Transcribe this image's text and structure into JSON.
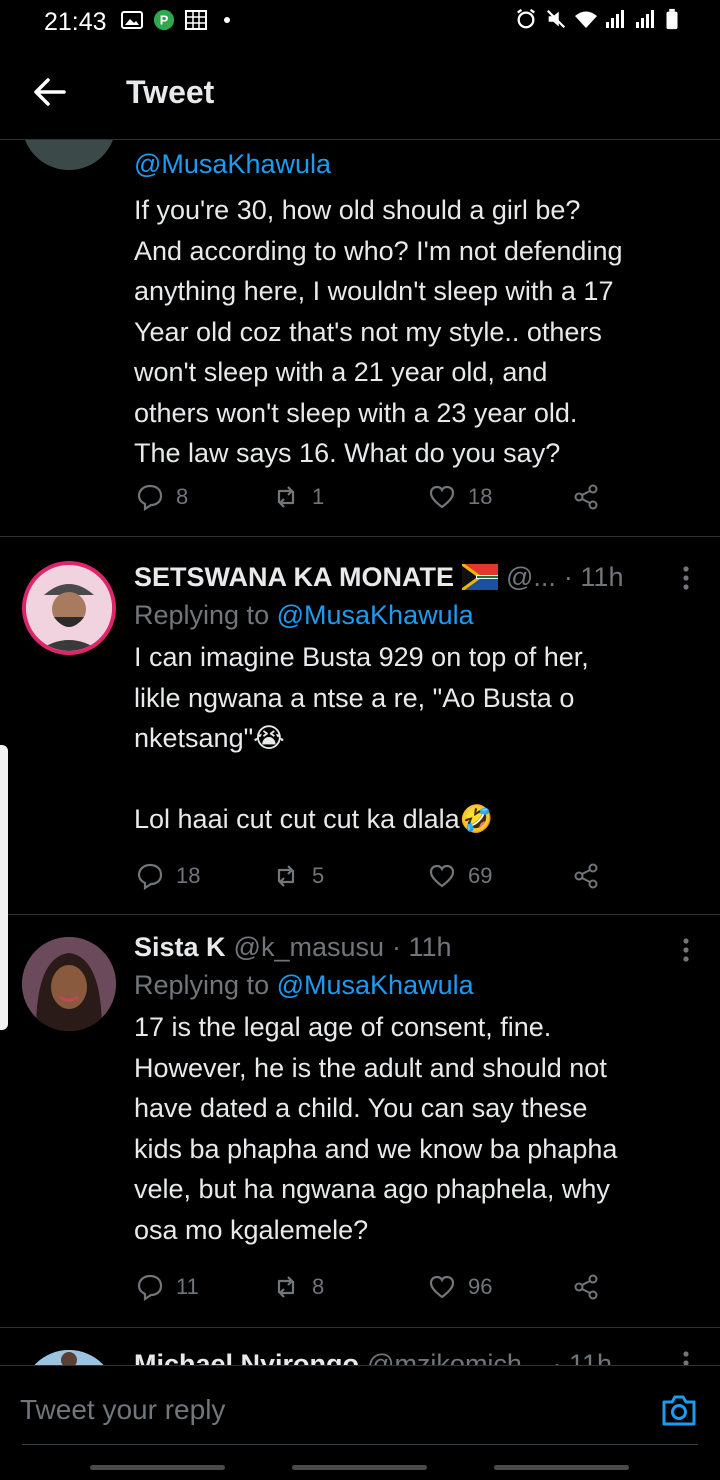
{
  "status_bar": {
    "time": "21:43"
  },
  "header": {
    "title": "Tweet"
  },
  "tweets": [
    {
      "handle": "@MusaKhawula",
      "lines": [
        "If you're 30, how old should a girl be?",
        "And according to who? I'm not defending",
        "anything here, I wouldn't sleep with a 17",
        "Year old coz that's not my style.. others",
        "won't sleep with a 21 year old, and",
        "others won't sleep with a 23 year old.",
        "The law says 16. What do you say?"
      ],
      "replies": "8",
      "retweets": "1",
      "likes": "18"
    },
    {
      "name": "SETSWANA KA MONATE",
      "handle": "@...",
      "time": "· 11h",
      "replying_label": "Replying to",
      "replying_to": "@MusaKhawula",
      "lines": [
        "I can imagine Busta 929 on top of her,",
        "likle ngwana a ntse a re, \"Ao Busta o",
        "nketsang\"😭",
        "",
        "Lol haai cut cut cut ka dlala🤣"
      ],
      "replies": "18",
      "retweets": "5",
      "likes": "69"
    },
    {
      "name": "Sista K",
      "handle": "@k_masusu",
      "time": "· 11h",
      "replying_label": "Replying to",
      "replying_to": "@MusaKhawula",
      "lines": [
        "17 is the legal age of consent, fine.",
        "However, he is the adult and should not",
        "have dated a child. You can say these",
        "kids ba phapha and we know ba phapha",
        "vele, but ha ngwana ago phaphela, why",
        "osa mo kgalemele?"
      ],
      "replies": "11",
      "retweets": "8",
      "likes": "96"
    },
    {
      "name": "Michael Nyirongo",
      "handle": "@mzikomich...",
      "time": "· 11h"
    }
  ],
  "reply_bar": {
    "placeholder": "Tweet your reply"
  },
  "colors": {
    "background": "#000000",
    "text": "#e7e9ea",
    "muted": "#71767b",
    "accent": "#1d9bf0"
  }
}
